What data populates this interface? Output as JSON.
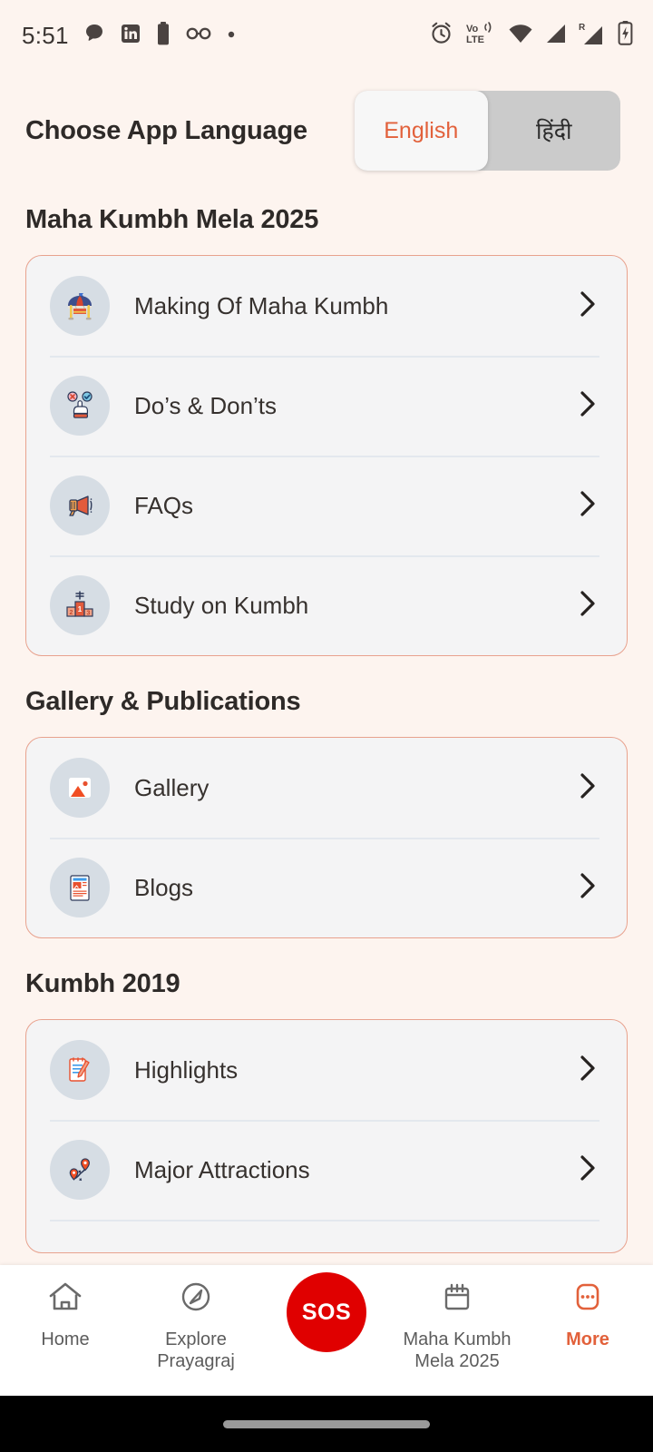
{
  "statusbar": {
    "time": "5:51",
    "left_icons": [
      "chat-bubble-icon",
      "linkedin-icon",
      "battery-saver-icon",
      "glasses-icon",
      "dot-icon"
    ],
    "right_icons": [
      "alarm-icon",
      "volte-icon",
      "wifi-icon",
      "signal-sim1-icon",
      "signal-roaming-icon",
      "battery-charging-icon"
    ],
    "volte_label_top": "Vo",
    "volte_label_bottom": "LTE",
    "roaming_label": "R"
  },
  "header": {
    "title": "Choose App Language",
    "languages": [
      {
        "label": "English",
        "active": true
      },
      {
        "label": "हिंदी",
        "active": false
      }
    ]
  },
  "sections": [
    {
      "title": "Maha Kumbh Mela 2025",
      "items": [
        {
          "label": "Making Of Maha Kumbh",
          "icon": "circus-tent-icon"
        },
        {
          "label": "Do’s & Don’ts",
          "icon": "pointing-hand-icon"
        },
        {
          "label": "FAQs",
          "icon": "megaphone-icon"
        },
        {
          "label": "Study on Kumbh",
          "icon": "podium-icon"
        }
      ]
    },
    {
      "title": "Gallery & Publications",
      "items": [
        {
          "label": "Gallery",
          "icon": "photo-icon"
        },
        {
          "label": "Blogs",
          "icon": "article-icon"
        }
      ]
    },
    {
      "title": "Kumbh 2019",
      "items": [
        {
          "label": "Highlights",
          "icon": "notepad-pen-icon"
        },
        {
          "label": "Major Attractions",
          "icon": "map-pins-icon"
        }
      ]
    }
  ],
  "bottomnav": {
    "items": [
      {
        "label": "Home",
        "icon": "home-icon",
        "active": false
      },
      {
        "label": "Explore\nPrayagraj",
        "icon": "compass-icon",
        "active": false
      },
      {
        "label": "SOS",
        "icon": "sos-button",
        "active": false
      },
      {
        "label": "Maha Kumbh\nMela 2025",
        "icon": "calendar-icon",
        "active": false
      },
      {
        "label": "More",
        "icon": "more-dots-icon",
        "active": true
      }
    ]
  },
  "colors": {
    "page_bg": "#FDF4EF",
    "card_bg": "#F4F4F5",
    "card_border": "#E8A28E",
    "accent": "#E2613B",
    "sos_red": "#E00000",
    "icon_circle": "#D6DDE4",
    "divider": "#E3E8EE",
    "heading": "#2E2A28"
  }
}
